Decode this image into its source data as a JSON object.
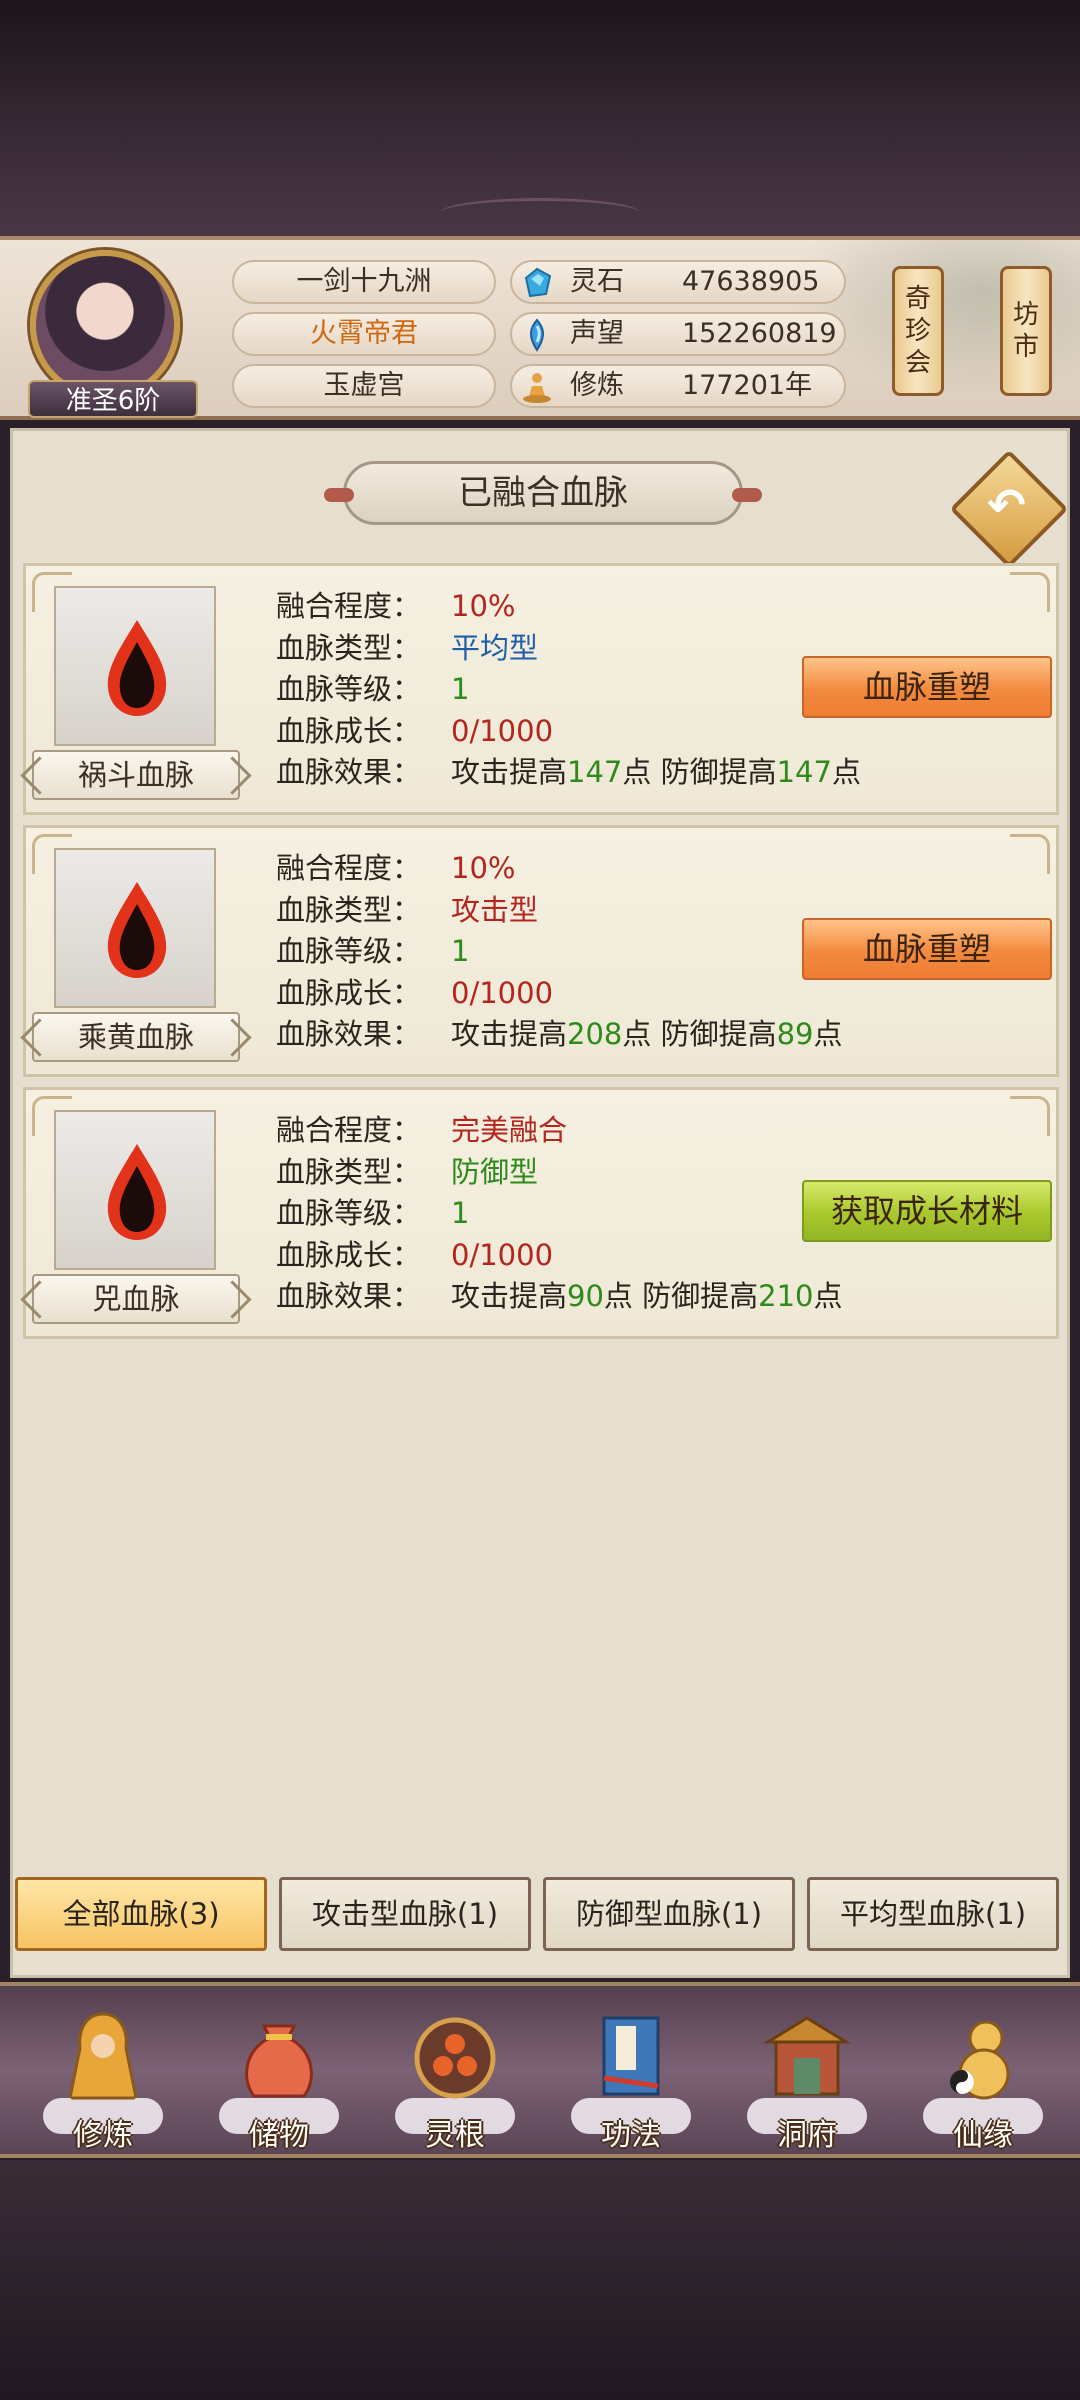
{
  "header": {
    "rank_badge": "准圣6阶",
    "server": "一剑十九洲",
    "title": "火霄帝君",
    "sect": "玉虚宫",
    "stats": [
      {
        "icon": "spirit-stone-icon",
        "label": "灵石",
        "value": "47638905"
      },
      {
        "icon": "reputation-crystal-icon",
        "label": "声望",
        "value": "152260819"
      },
      {
        "icon": "cultivation-meditation-icon",
        "label": "修炼",
        "value": "177201年"
      }
    ],
    "side_buttons": [
      {
        "name": "treasure-market-button",
        "lines": [
          "奇",
          "珍",
          "会"
        ]
      },
      {
        "name": "market-button",
        "lines": [
          "坊",
          "市"
        ]
      }
    ]
  },
  "panel": {
    "title": "已融合血脉",
    "back_icon": "back-arrow-icon",
    "cards": [
      {
        "name": "祸斗血脉",
        "rows": [
          {
            "key": "融合程度：",
            "value": "10%"
          },
          {
            "key": "血脉类型：",
            "value": "平均型"
          },
          {
            "key": "血脉等级：",
            "value": "1"
          },
          {
            "key": "血脉成长：",
            "value": "0/1000"
          }
        ],
        "effect_key": "血脉效果：",
        "effect": {
          "a": "攻击提高",
          "b": "147",
          "c": "点 防御提高",
          "d": "147",
          "e": "点"
        },
        "button": "血脉重塑"
      },
      {
        "name": "乘黄血脉",
        "rows": [
          {
            "key": "融合程度：",
            "value": "10%"
          },
          {
            "key": "血脉类型：",
            "value": "攻击型"
          },
          {
            "key": "血脉等级：",
            "value": "1"
          },
          {
            "key": "血脉成长：",
            "value": "0/1000"
          }
        ],
        "effect_key": "血脉效果：",
        "effect": {
          "a": "攻击提高",
          "b": "208",
          "c": "点 防御提高",
          "d": "89",
          "e": "点"
        },
        "button": "血脉重塑"
      },
      {
        "name": "兕血脉",
        "rows": [
          {
            "key": "融合程度：",
            "value": "完美融合"
          },
          {
            "key": "血脉类型：",
            "value": "防御型"
          },
          {
            "key": "血脉等级：",
            "value": "1"
          },
          {
            "key": "血脉成长：",
            "value": "0/1000"
          }
        ],
        "effect_key": "血脉效果：",
        "effect": {
          "a": "攻击提高",
          "b": "90",
          "c": "点 防御提高",
          "d": "210",
          "e": "点"
        },
        "button": "获取成长材料"
      }
    ],
    "tabs": [
      "全部血脉(3)",
      "攻击型血脉(1)",
      "防御型血脉(1)",
      "平均型血脉(1)"
    ],
    "active_tab": "全部血脉(3)"
  },
  "nav": [
    {
      "label": "修炼",
      "icon": "cultivate-monk-icon"
    },
    {
      "label": "储物",
      "icon": "storage-bag-icon"
    },
    {
      "label": "灵根",
      "icon": "spirit-root-icon"
    },
    {
      "label": "功法",
      "icon": "technique-book-icon"
    },
    {
      "label": "洞府",
      "icon": "cave-mansion-icon"
    },
    {
      "label": "仙缘",
      "icon": "immortal-fate-gourd-icon"
    }
  ],
  "colors": {
    "red_value": "#b3261e",
    "blue_value": "#1f5fa8",
    "green_value": "#2f8a1c",
    "orange_title": "#d06a12",
    "active_tab": "#f6c463"
  }
}
